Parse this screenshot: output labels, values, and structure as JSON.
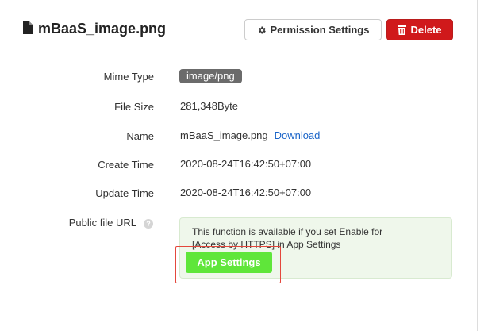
{
  "header": {
    "title": "mBaaS_image.png",
    "permission_button": "Permission Settings",
    "delete_button": "Delete"
  },
  "details": {
    "mime_type": {
      "label": "Mime Type",
      "value": "image/png"
    },
    "file_size": {
      "label": "File Size",
      "value": "281,348Byte"
    },
    "name": {
      "label": "Name",
      "value": "mBaaS_image.png",
      "link": "Download"
    },
    "create_time": {
      "label": "Create Time",
      "value": "2020-08-24T16:42:50+07:00"
    },
    "update_time": {
      "label": "Update Time",
      "value": "2020-08-24T16:42:50+07:00"
    },
    "public_url": {
      "label": "Public file URL",
      "help": "?",
      "message_line1": "This function is available if you set Enable for",
      "message_line2": "[Access by HTTPS] in App Settings",
      "button": "App Settings"
    }
  },
  "colors": {
    "delete": "#d0191b",
    "app_settings": "#5fe63a",
    "highlight": "#e4473c",
    "link": "#1a64c8"
  }
}
